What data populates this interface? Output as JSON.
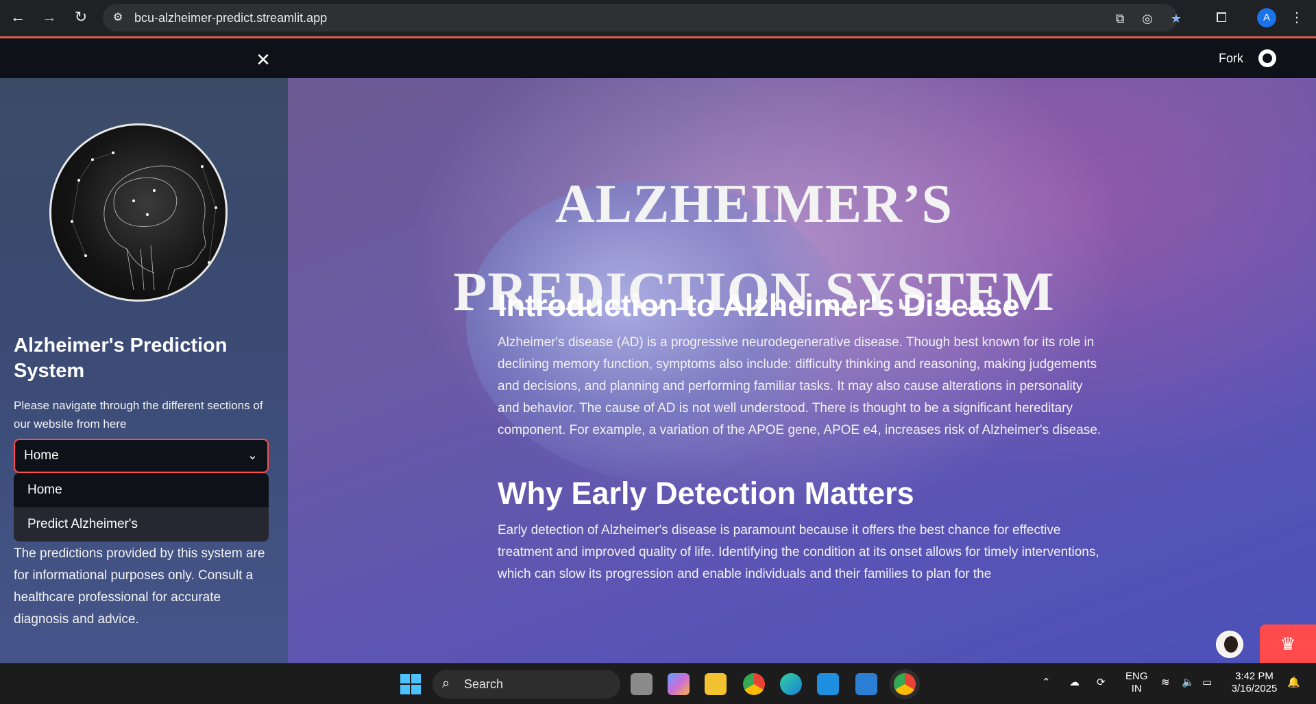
{
  "browser": {
    "url": "bcu-alzheimer-predict.streamlit.app",
    "profile_initial": "A"
  },
  "header": {
    "fork_label": "Fork"
  },
  "sidebar": {
    "title": "Alzheimer's Prediction System",
    "description": "Please navigate through the different sections of our website from here",
    "select_value": "Home",
    "options": [
      "Home",
      "Predict Alzheimer's"
    ],
    "disclaimer": "The predictions provided by this system are for informational purposes only. Consult a healthcare professional for accurate diagnosis and advice."
  },
  "main": {
    "hero_line1": "ALZHEIMER’S",
    "hero_line2": "PREDICTION SYSTEM",
    "section1_title": "Introduction to Alzheimer's Disease",
    "section1_text": "Alzheimer's disease (AD) is a progressive neurodegenerative disease. Though best known for its role in declining memory function, symptoms also include: difficulty thinking and reasoning, making judgements and decisions, and planning and performing familiar tasks. It may also cause alterations in personality and behavior. The cause of AD is not well understood. There is thought to be a significant hereditary component. For example, a variation of the APOE gene, APOE e4, increases risk of Alzheimer's disease.",
    "section2_title": "Why Early Detection Matters",
    "section2_text": "Early detection of Alzheimer's disease is paramount because it offers the best chance for effective treatment and improved quality of life. Identifying the condition at its onset allows for timely interventions, which can slow its progression and enable individuals and their families to plan for the"
  },
  "taskbar": {
    "search_label": "Search",
    "lang_line1": "ENG",
    "lang_line2": "IN",
    "time": "3:42 PM",
    "date": "3/16/2025"
  }
}
